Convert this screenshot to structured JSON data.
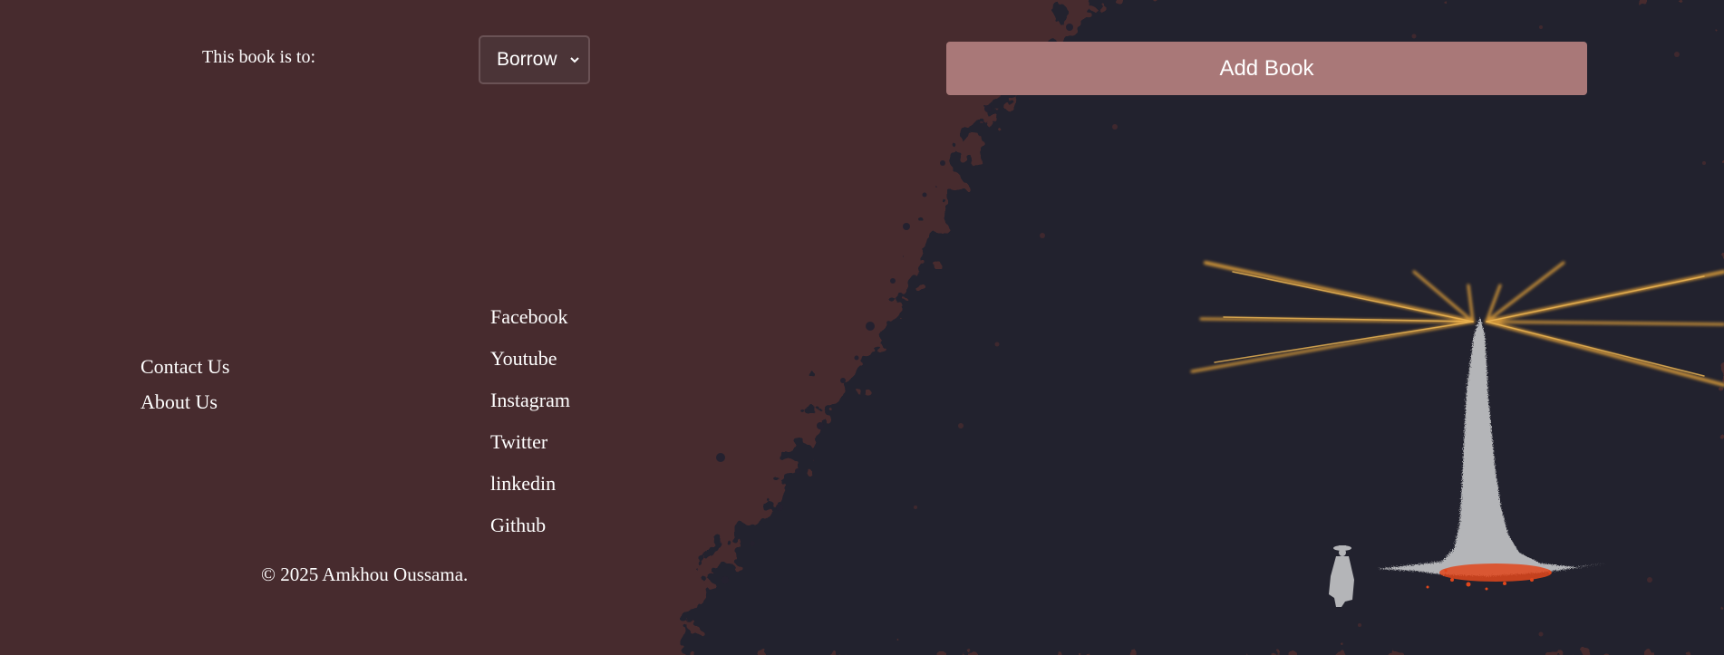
{
  "form": {
    "purpose_label": "This book is to:",
    "purpose_selected": "Borrow",
    "add_button": "Add Book"
  },
  "footer": {
    "links": [
      "Contact Us",
      "About Us"
    ],
    "social": [
      "Facebook",
      "Youtube",
      "Instagram",
      "Twitter",
      "linkedin",
      "Github"
    ],
    "copyright": "© 2025 Amkhou Oussama."
  },
  "colors": {
    "background": "#472b2e",
    "art_background": "#24212f",
    "button": "#a97878",
    "select_bg": "#4b3437",
    "tower": "#b4b5b8",
    "rays": "#e2a13b",
    "embers": "#e0461b"
  },
  "icons": [
    "chevron-down-icon",
    "dark-tower-illustration"
  ]
}
